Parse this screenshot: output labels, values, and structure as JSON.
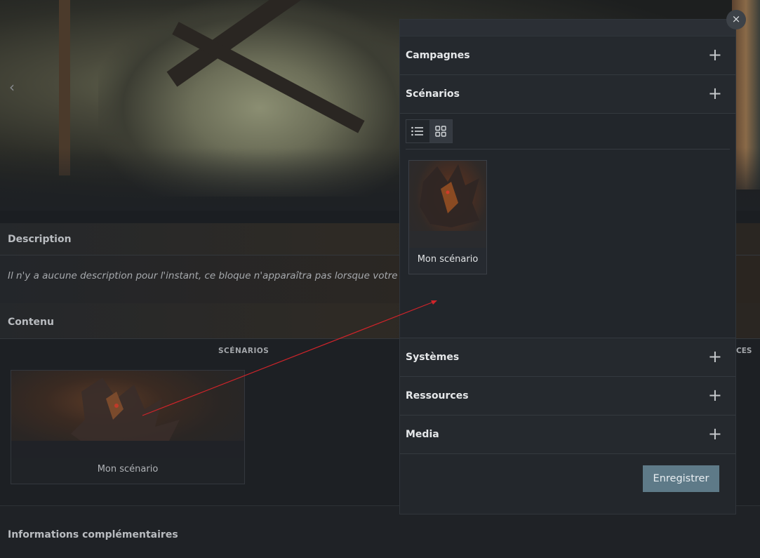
{
  "hero": {
    "prev_arrow": "‹"
  },
  "description": {
    "title": "Description",
    "text": "Il n'y a aucune description pour l'instant, ce bloque n'apparaîtra pas lorsque votre prod"
  },
  "content": {
    "title": "Contenu",
    "tab_scenarios": "SCÉNARIOS",
    "tab_overflow": "CES",
    "card_title": "Mon scénario"
  },
  "info": {
    "title": "Informations complémentaires"
  },
  "panel": {
    "close_glyph": "×",
    "sections": [
      {
        "label": "Campagnes",
        "icon": "plus-icon"
      },
      {
        "label": "Scénarios",
        "icon": "plus-icon"
      },
      {
        "label": "Systèmes",
        "icon": "plus-icon"
      },
      {
        "label": "Ressources",
        "icon": "plus-icon"
      },
      {
        "label": "Media",
        "icon": "plus-icon"
      }
    ],
    "plus_glyph": "+",
    "view_list_icon": "list-icon",
    "view_grid_icon": "grid-icon",
    "card_title": "Mon scénario",
    "save_label": "Enregistrer"
  },
  "colors": {
    "accent_button": "#5e7a88",
    "connector": "#d0242a",
    "panel_bg": "#23272c"
  }
}
